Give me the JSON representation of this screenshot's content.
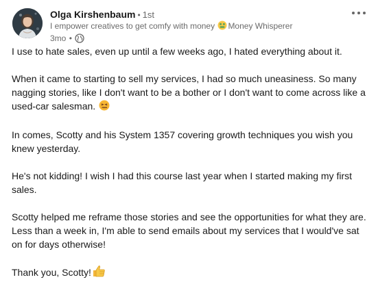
{
  "post": {
    "author": {
      "name": "Olga Kirshenbaum",
      "degree": "1st",
      "headline_prefix": "I empower creatives to get comfy with money",
      "headline_suffix": "Money Whisperer",
      "headline_emoji": "money-mouth-face-emoji"
    },
    "timestamp": "3mo",
    "visibility_icon": "globe-icon",
    "more_icon": "ellipsis-icon",
    "paragraphs": [
      "I use to hate sales, even up until a few weeks ago, I hated everything about it.",
      "When it came to starting to sell my services, I had so much uneasiness. So many nagging stories, like I don't want to be a bother or I don't want to come across like a used-car salesman.",
      "In comes, Scotty and his System 1357 covering growth techniques you wish you knew yesterday.",
      "He's not kidding! I wish I had this course last year when I started making my first sales.",
      "Scotty helped me reframe those stories and see the opportunities for what they are. Less than a week in, I'm able to send emails about my services that I would've sat on for days otherwise!",
      "Thank you, Scotty!"
    ],
    "emojis": {
      "paragraph_2": "persevering-face-emoji",
      "paragraph_6": "thumbs-up-emoji"
    }
  },
  "colors": {
    "text_primary": "#1f1f1f",
    "text_secondary": "#666666",
    "background": "#ffffff"
  }
}
